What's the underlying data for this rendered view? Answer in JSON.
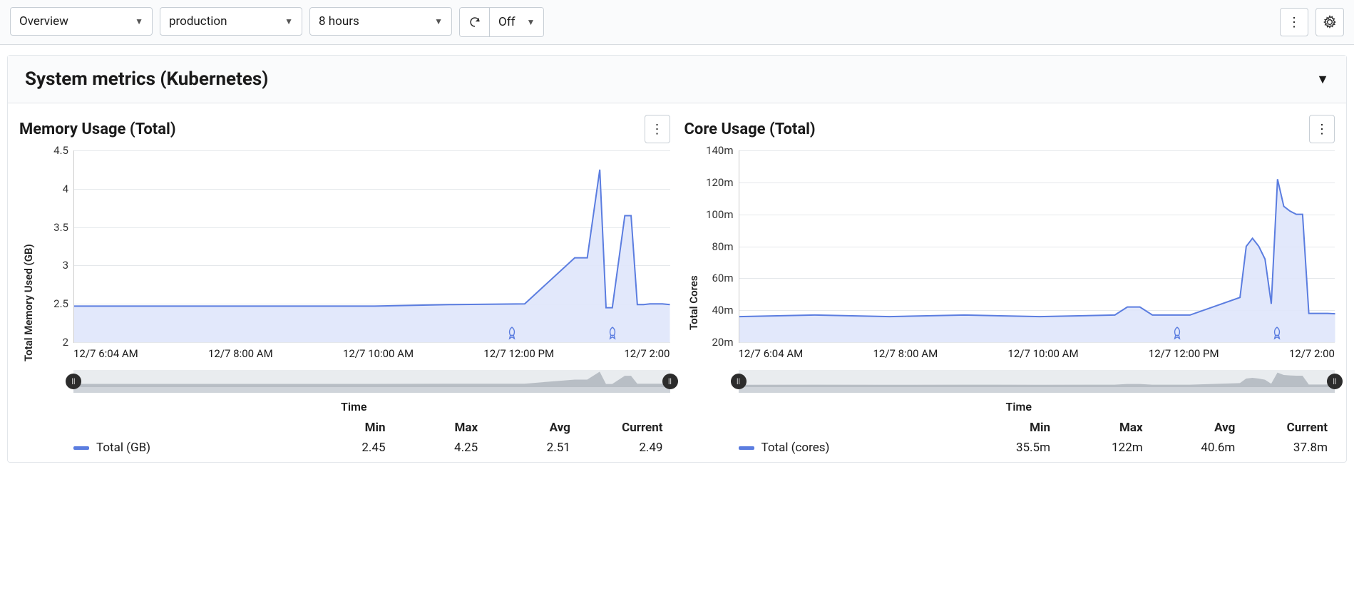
{
  "toolbar": {
    "view_select": "Overview",
    "env_select": "production",
    "range_select": "8 hours",
    "refresh_off": "Off"
  },
  "section": {
    "title": "System metrics (Kubernetes)"
  },
  "panels": [
    {
      "title": "Memory Usage (Total)",
      "ylabel": "Total Memory Used (GB)",
      "xlabel": "Time",
      "stats_headers": [
        "Min",
        "Max",
        "Avg",
        "Current"
      ],
      "legend": "Total (GB)",
      "stats": [
        "2.45",
        "4.25",
        "2.51",
        "2.49"
      ]
    },
    {
      "title": "Core Usage (Total)",
      "ylabel": "Total Cores",
      "xlabel": "Time",
      "stats_headers": [
        "Min",
        "Max",
        "Avg",
        "Current"
      ],
      "legend": "Total (cores)",
      "stats": [
        "35.5m",
        "122m",
        "40.6m",
        "37.8m"
      ]
    }
  ],
  "chart_data": [
    {
      "type": "area",
      "title": "Memory Usage (Total)",
      "xlabel": "Time",
      "ylabel": "Total Memory Used (GB)",
      "ylim": [
        2,
        4.5
      ],
      "y_ticks": [
        2,
        2.5,
        3,
        3.5,
        4,
        4.5
      ],
      "x_tick_labels": [
        "12/7 6:04 AM",
        "12/7 8:00 AM",
        "12/7 10:00 AM",
        "12/7 12:00 PM",
        "12/7 2:00"
      ],
      "x_minutes": [
        0,
        60,
        120,
        180,
        240,
        300,
        360,
        400,
        410,
        420,
        425,
        430,
        440,
        445,
        450,
        455,
        460,
        470,
        476
      ],
      "series": [
        {
          "name": "Total (GB)",
          "values": [
            2.47,
            2.47,
            2.47,
            2.47,
            2.47,
            2.49,
            2.5,
            3.1,
            3.1,
            4.25,
            2.45,
            2.45,
            3.65,
            3.65,
            2.49,
            2.49,
            2.5,
            2.5,
            2.49
          ]
        }
      ],
      "annotations_x_minutes": [
        350,
        430
      ],
      "legend": [
        "Total (GB)"
      ],
      "stats": {
        "Min": "2.45",
        "Max": "4.25",
        "Avg": "2.51",
        "Current": "2.49"
      }
    },
    {
      "type": "area",
      "title": "Core Usage (Total)",
      "xlabel": "Time",
      "ylabel": "Total Cores",
      "ylim": [
        20,
        140
      ],
      "y_ticks": [
        20,
        40,
        60,
        80,
        100,
        120,
        140
      ],
      "y_tick_labels": [
        "20m",
        "40m",
        "60m",
        "80m",
        "100m",
        "120m",
        "140m"
      ],
      "x_tick_labels": [
        "12/7 6:04 AM",
        "12/7 8:00 AM",
        "12/7 10:00 AM",
        "12/7 12:00 PM",
        "12/7 2:00"
      ],
      "x_minutes": [
        0,
        60,
        120,
        180,
        240,
        300,
        310,
        320,
        330,
        360,
        400,
        405,
        410,
        415,
        420,
        425,
        430,
        435,
        440,
        445,
        450,
        455,
        460,
        470,
        476
      ],
      "series": [
        {
          "name": "Total (cores)",
          "values": [
            36,
            37,
            36,
            37,
            36,
            37,
            42,
            42,
            37,
            37,
            48,
            80,
            85,
            80,
            72,
            44,
            122,
            105,
            102,
            100,
            100,
            38,
            38,
            38,
            37.8
          ]
        }
      ],
      "annotations_x_minutes": [
        350,
        430
      ],
      "legend": [
        "Total (cores)"
      ],
      "stats": {
        "Min": "35.5m",
        "Max": "122m",
        "Avg": "40.6m",
        "Current": "37.8m"
      }
    }
  ]
}
